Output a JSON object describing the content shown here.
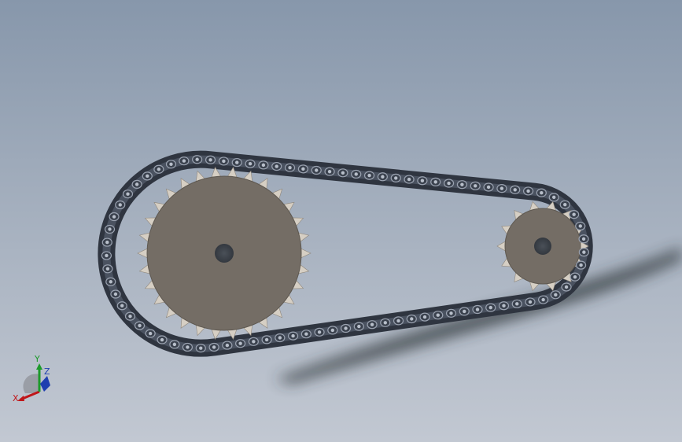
{
  "viewport": {
    "background_top": "#8797ab",
    "background_bottom": "#c2c8d2"
  },
  "model": {
    "large_sprocket": {
      "teeth": 30,
      "color": "#746d65"
    },
    "small_sprocket": {
      "teeth": 14,
      "color": "#746d65"
    },
    "chain": {
      "color": "#2f3540",
      "link_color": "#9aa2b0"
    }
  },
  "triad": {
    "x_label": "X",
    "y_label": "Y",
    "z_label": "Z",
    "x_color": "#c0161a",
    "y_color": "#1c9a2a",
    "z_color": "#1f3fb0"
  }
}
